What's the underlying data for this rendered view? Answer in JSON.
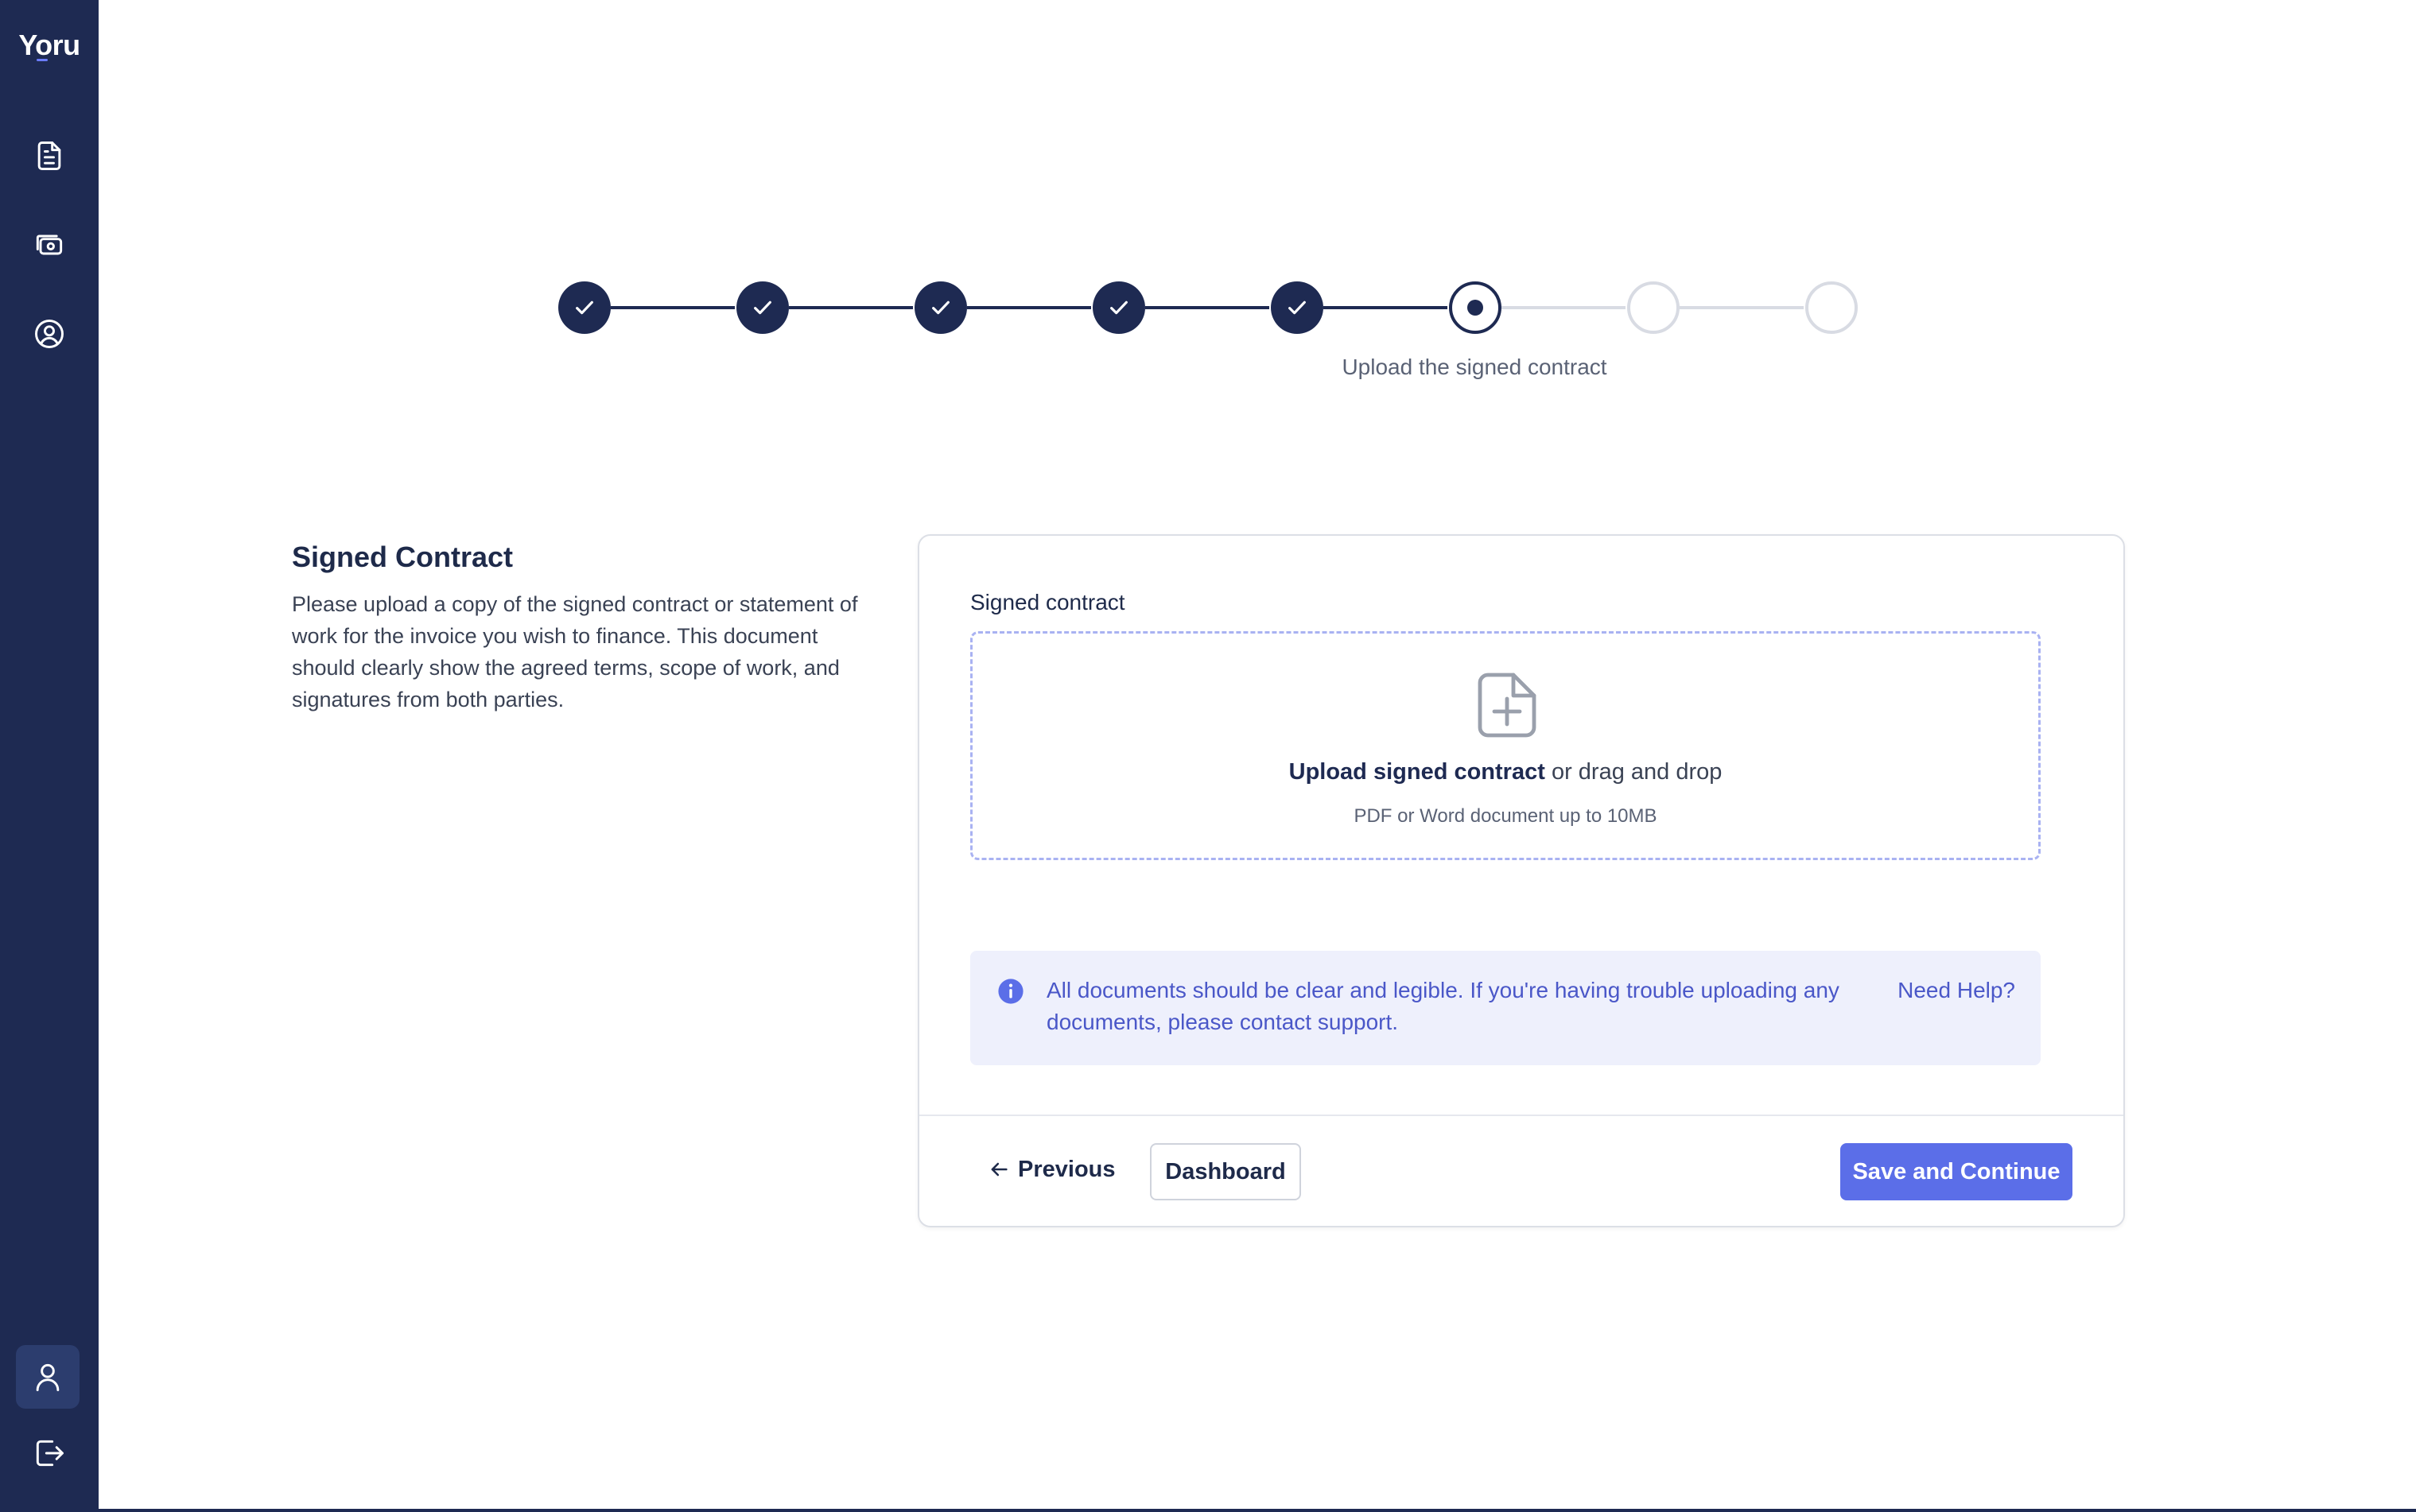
{
  "sidebar": {
    "logo": "Yoru",
    "nav_icons": [
      "document-icon",
      "money-icon",
      "user-circle-icon"
    ],
    "bottom_icons": [
      "user-icon",
      "logout-icon"
    ],
    "colors": {
      "background": "#1e2a52",
      "active": "#2c3d6e"
    }
  },
  "stepper": {
    "total_steps": 8,
    "completed_steps": 5,
    "current_step": 6,
    "current_label": "Upload the signed contract"
  },
  "intro": {
    "title": "Signed Contract",
    "description": "Please upload a copy of the signed contract or statement of work for the invoice you wish to finance. This document should clearly show the agreed terms, scope of work, and signatures from both parties."
  },
  "form": {
    "field_label": "Signed contract",
    "dropzone": {
      "link_text": "Upload signed contract",
      "rest_text": " or drag and drop",
      "hint": "PDF or Word document up to 10MB"
    },
    "info": {
      "text": "All documents should be clear and legible. If you're having trouble uploading any documents, please contact support.",
      "help_link": "Need Help?"
    },
    "buttons": {
      "previous": "Previous",
      "dashboard": "Dashboard",
      "save": "Save and Continue"
    }
  },
  "colors": {
    "accent": "#5b6ee8",
    "info_bg": "#eef0fc",
    "info_text": "#4a57c8",
    "navy": "#1e2a52"
  }
}
